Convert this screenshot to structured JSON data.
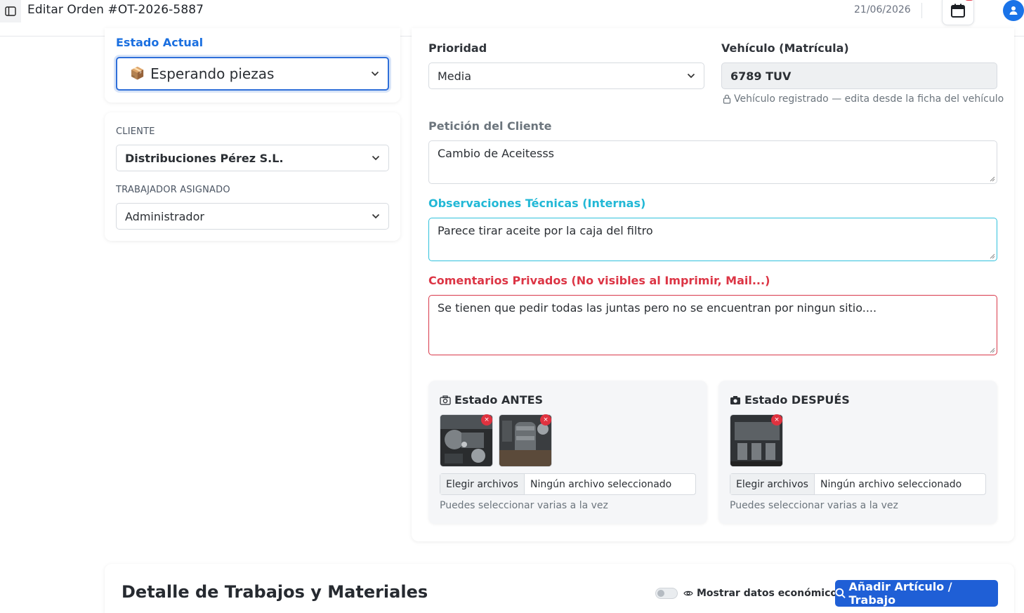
{
  "header": {
    "title": "Editar Orden #OT-2026-5887",
    "date": "21/06/2026"
  },
  "status_card": {
    "label": "Estado Actual",
    "value_icon": "📦",
    "value": "Esperando piezas"
  },
  "assignment_card": {
    "client_label": "CLIENTE",
    "client_value": "Distribuciones Pérez S.L.",
    "worker_label": "TRABAJADOR ASIGNADO",
    "worker_value": "Administrador"
  },
  "details": {
    "priority_label": "Prioridad",
    "priority_value": "Media",
    "vehicle_label": "Vehículo (Matrícula)",
    "vehicle_value": "6789 TUV",
    "vehicle_hint": "Vehículo registrado — edita desde la ficha del vehículo",
    "request_label": "Petición del Cliente",
    "request_value": "Cambio de Aceitesss",
    "tech_label": "Observaciones Técnicas (Internas)",
    "tech_value": "Parece tirar aceite por la caja del filtro",
    "private_label": "Comentarios Privados (No visibles al Imprimir, Mail...)",
    "private_value": "Se tienen que pedir todas las juntas pero no se encuentran por ningun sitio...."
  },
  "photos_before": {
    "title": "Estado ANTES",
    "choose_label": "Elegir archivos",
    "file_status": "Ningún archivo seleccionado",
    "hint": "Puedes seleccionar varias a la vez",
    "delete_glyph": "×"
  },
  "photos_after": {
    "title": "Estado DESPUÉS",
    "choose_label": "Elegir archivos",
    "file_status": "Ningún archivo seleccionado",
    "hint": "Puedes seleccionar varias a la vez",
    "delete_glyph": "×"
  },
  "works": {
    "title": "Detalle de Trabajos y Materiales",
    "toggle_label": "Mostrar datos económicos",
    "toggle_on": false,
    "add_button": "Añadir Artículo / Trabajo"
  },
  "icons": {
    "sidebar": "sidebar-toggle-icon",
    "calendar": "calendar-icon",
    "avatar": "user-icon",
    "chevron": "chevron-down-icon",
    "lock": "lock-icon",
    "camera_outline": "camera-outline-icon",
    "camera_filled": "camera-filled-icon",
    "eye": "eye-icon",
    "search": "search-icon"
  },
  "colors": {
    "primary": "#1f5fd6",
    "status_label": "#1a6fe0",
    "tech_label": "#22b8d6",
    "private_label": "#dc3545",
    "badge": "#e53e4f"
  }
}
